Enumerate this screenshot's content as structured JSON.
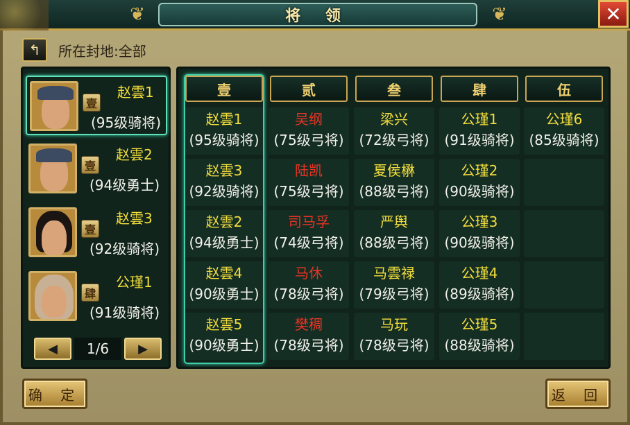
{
  "window": {
    "title": "将 领",
    "close_label": "✕"
  },
  "header": {
    "back_icon": "↰",
    "fief_label": "所在封地:全部"
  },
  "generals": [
    {
      "name": "赵雲1",
      "rank_badge": "壹",
      "info": "(95级骑将)",
      "portrait": "male-warrior"
    },
    {
      "name": "赵雲2",
      "rank_badge": "壹",
      "info": "(94级勇士)",
      "portrait": "male-warrior"
    },
    {
      "name": "赵雲3",
      "rank_badge": "壹",
      "info": "(92级骑将)",
      "portrait": "female"
    },
    {
      "name": "公瑾1",
      "rank_badge": "肆",
      "info": "(91级骑将)",
      "portrait": "young-male"
    }
  ],
  "pager": {
    "prev_icon": "◀",
    "next_icon": "▶",
    "page": "1/6"
  },
  "columns": [
    "壹",
    "贰",
    "叁",
    "肆",
    "伍"
  ],
  "grid": [
    [
      {
        "name": "赵雲1",
        "info": "(95级骑将)",
        "color": "yellow"
      },
      {
        "name": "赵雲3",
        "info": "(92级骑将)",
        "color": "yellow"
      },
      {
        "name": "赵雲2",
        "info": "(94级勇士)",
        "color": "yellow"
      },
      {
        "name": "赵雲4",
        "info": "(90级勇士)",
        "color": "yellow"
      },
      {
        "name": "赵雲5",
        "info": "(90级勇士)",
        "color": "yellow"
      }
    ],
    [
      {
        "name": "吴纲",
        "info": "(75级弓将)",
        "color": "red"
      },
      {
        "name": "陆凯",
        "info": "(75级弓将)",
        "color": "red"
      },
      {
        "name": "司马孚",
        "info": "(74级弓将)",
        "color": "red"
      },
      {
        "name": "马休",
        "info": "(78级弓将)",
        "color": "red"
      },
      {
        "name": "樊稠",
        "info": "(78级弓将)",
        "color": "red"
      }
    ],
    [
      {
        "name": "梁兴",
        "info": "(72级弓将)",
        "color": "yellow"
      },
      {
        "name": "夏侯楙",
        "info": "(88级弓将)",
        "color": "yellow"
      },
      {
        "name": "严舆",
        "info": "(88级弓将)",
        "color": "yellow"
      },
      {
        "name": "马雲禄",
        "info": "(79级弓将)",
        "color": "yellow"
      },
      {
        "name": "马玩",
        "info": "(78级弓将)",
        "color": "yellow"
      }
    ],
    [
      {
        "name": "公瑾1",
        "info": "(91级骑将)",
        "color": "yellow"
      },
      {
        "name": "公瑾2",
        "info": "(90级骑将)",
        "color": "yellow"
      },
      {
        "name": "公瑾3",
        "info": "(90级骑将)",
        "color": "yellow"
      },
      {
        "name": "公瑾4",
        "info": "(89级骑将)",
        "color": "yellow"
      },
      {
        "name": "公瑾5",
        "info": "(88级骑将)",
        "color": "yellow"
      }
    ],
    [
      {
        "name": "公瑾6",
        "info": "(85级骑将)",
        "color": "yellow"
      },
      {
        "name": "",
        "info": "",
        "color": "yellow"
      },
      {
        "name": "",
        "info": "",
        "color": "yellow"
      },
      {
        "name": "",
        "info": "",
        "color": "yellow"
      },
      {
        "name": "",
        "info": "",
        "color": "yellow"
      }
    ]
  ],
  "colors": {
    "yellow": "#f2de3c",
    "red": "#e83424",
    "highlight": "#3ed0a8"
  },
  "footer": {
    "confirm_label": "确 定",
    "return_label": "返 回"
  }
}
